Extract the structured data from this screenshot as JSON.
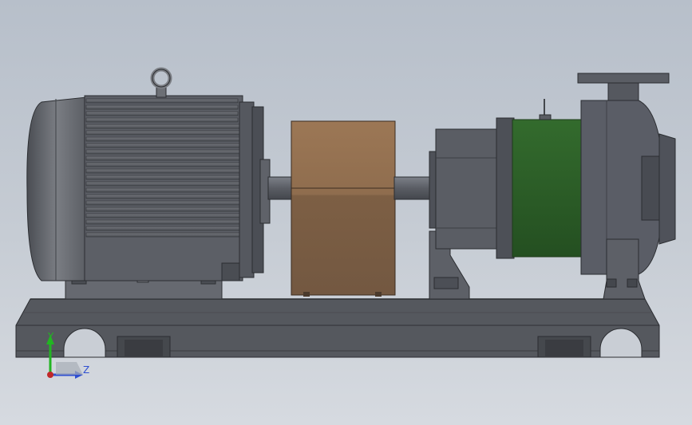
{
  "triad": {
    "y_label": "Y",
    "z_label": "Z"
  },
  "colors": {
    "background_top": "#b7bfca",
    "background_bottom": "#d6dae0",
    "motor_body": "#5c5f66",
    "motor_dark": "#3d4046",
    "coupling_guard": "#8a6a4c",
    "magnet_housing": "#2f5e2a",
    "pump_casing": "#5a5d66",
    "baseplate": "#55585e",
    "axis_y": "#22b522",
    "axis_z": "#2f4fd0",
    "axis_origin": "#c0282a"
  }
}
